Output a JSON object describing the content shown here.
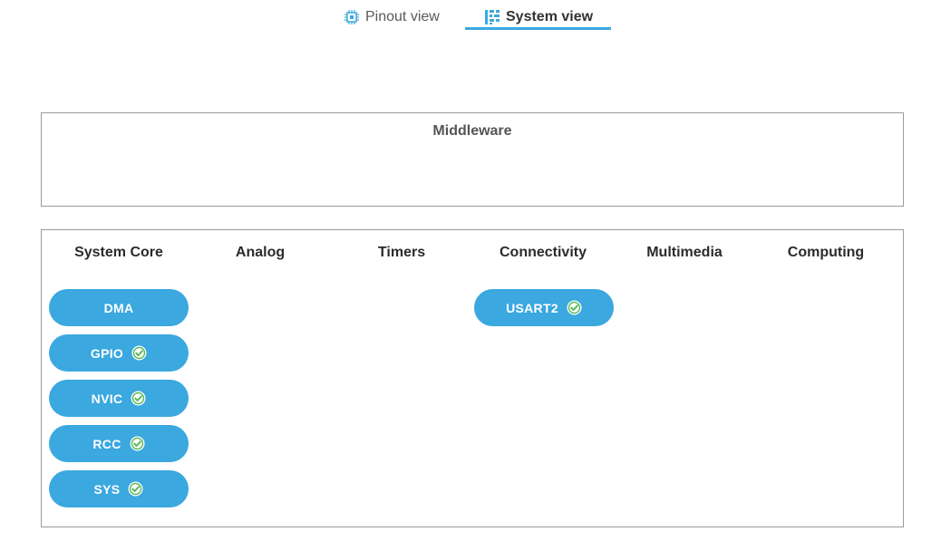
{
  "tabs": {
    "pinout_label": "Pinout view",
    "system_label": "System view",
    "active": "system"
  },
  "middleware": {
    "title": "Middleware"
  },
  "categories": [
    {
      "label": "System Core"
    },
    {
      "label": "Analog"
    },
    {
      "label": "Timers"
    },
    {
      "label": "Connectivity"
    },
    {
      "label": "Multimedia"
    },
    {
      "label": "Computing"
    }
  ],
  "peripherals": {
    "system_core": [
      {
        "label": "DMA",
        "configured": false
      },
      {
        "label": "GPIO",
        "configured": true
      },
      {
        "label": "NVIC",
        "configured": true
      },
      {
        "label": "RCC",
        "configured": true
      },
      {
        "label": "SYS",
        "configured": true
      }
    ],
    "connectivity": [
      {
        "label": "USART2",
        "configured": true
      }
    ]
  },
  "colors": {
    "accent": "#3ba8e0",
    "check_fill": "#ffffff",
    "check_mark": "#5cb85c",
    "border": "#9a9a9a"
  },
  "icons": {
    "pinout_tab": "chip-icon",
    "system_tab": "system-grid-icon",
    "configured": "check-circle-icon"
  }
}
